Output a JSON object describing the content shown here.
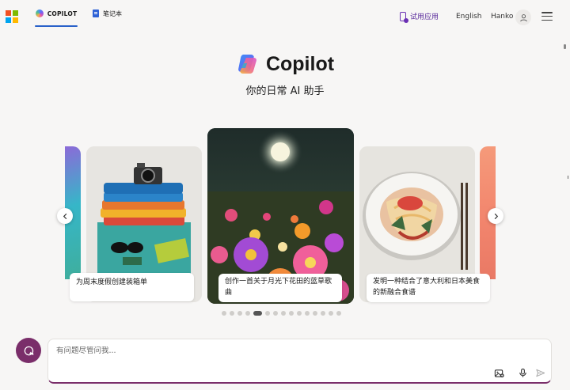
{
  "header": {
    "tabs": [
      {
        "label": "COPILOT",
        "active": true
      },
      {
        "label": "笔记本",
        "active": false
      }
    ],
    "try_app": "试用应用",
    "language": "English",
    "user_name": "Hanko"
  },
  "hero": {
    "brand": "Copilot",
    "subtitle": "你的日常 AI 助手"
  },
  "carousel": {
    "cards": [
      {
        "caption": "为周末度假创建装箱单",
        "image": "folded-clothes-camera-sunglasses"
      },
      {
        "caption": "创作一首关于月光下花田的蓝草歌曲",
        "image": "moonlit-flower-field"
      },
      {
        "caption": "发明一种结合了意大利和日本美食的新融合食谱",
        "image": "fusion-pasta-dish"
      }
    ],
    "prev_icon": "chevron-left-icon",
    "next_icon": "chevron-right-icon",
    "dot_count": 15,
    "active_dot": 4
  },
  "composer": {
    "placeholder": "有问题尽管问我...",
    "icons": [
      "image-icon",
      "microphone-icon",
      "send-icon"
    ]
  },
  "colors": {
    "accent": "#7a2e6a",
    "tab_underline": "#2a61c9",
    "try_app": "#5a2b9c"
  }
}
